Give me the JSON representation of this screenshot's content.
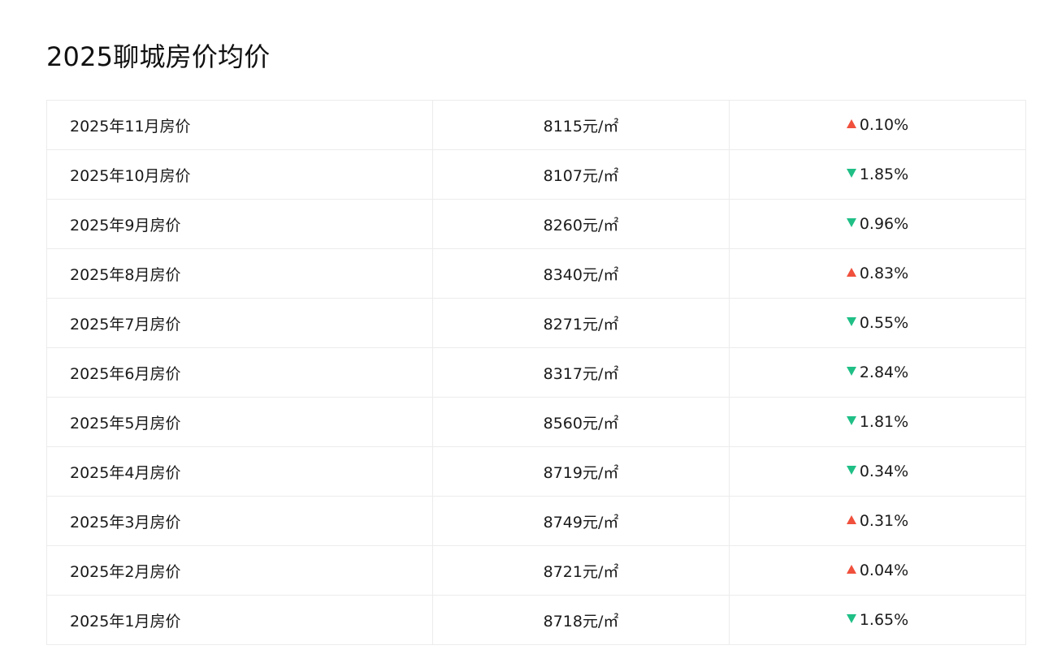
{
  "title": "2025聊城房价均价",
  "colors": {
    "up": "#f0503c",
    "down": "#1fbf86"
  },
  "rows": [
    {
      "month": "2025年11月房价",
      "price": "8115元/㎡",
      "direction": "up",
      "change": "0.10%"
    },
    {
      "month": "2025年10月房价",
      "price": "8107元/㎡",
      "direction": "down",
      "change": "1.85%"
    },
    {
      "month": "2025年9月房价",
      "price": "8260元/㎡",
      "direction": "down",
      "change": "0.96%"
    },
    {
      "month": "2025年8月房价",
      "price": "8340元/㎡",
      "direction": "up",
      "change": "0.83%"
    },
    {
      "month": "2025年7月房价",
      "price": "8271元/㎡",
      "direction": "down",
      "change": "0.55%"
    },
    {
      "month": "2025年6月房价",
      "price": "8317元/㎡",
      "direction": "down",
      "change": "2.84%"
    },
    {
      "month": "2025年5月房价",
      "price": "8560元/㎡",
      "direction": "down",
      "change": "1.81%"
    },
    {
      "month": "2025年4月房价",
      "price": "8719元/㎡",
      "direction": "down",
      "change": "0.34%"
    },
    {
      "month": "2025年3月房价",
      "price": "8749元/㎡",
      "direction": "up",
      "change": "0.31%"
    },
    {
      "month": "2025年2月房价",
      "price": "8721元/㎡",
      "direction": "up",
      "change": "0.04%"
    },
    {
      "month": "2025年1月房价",
      "price": "8718元/㎡",
      "direction": "down",
      "change": "1.65%"
    }
  ]
}
